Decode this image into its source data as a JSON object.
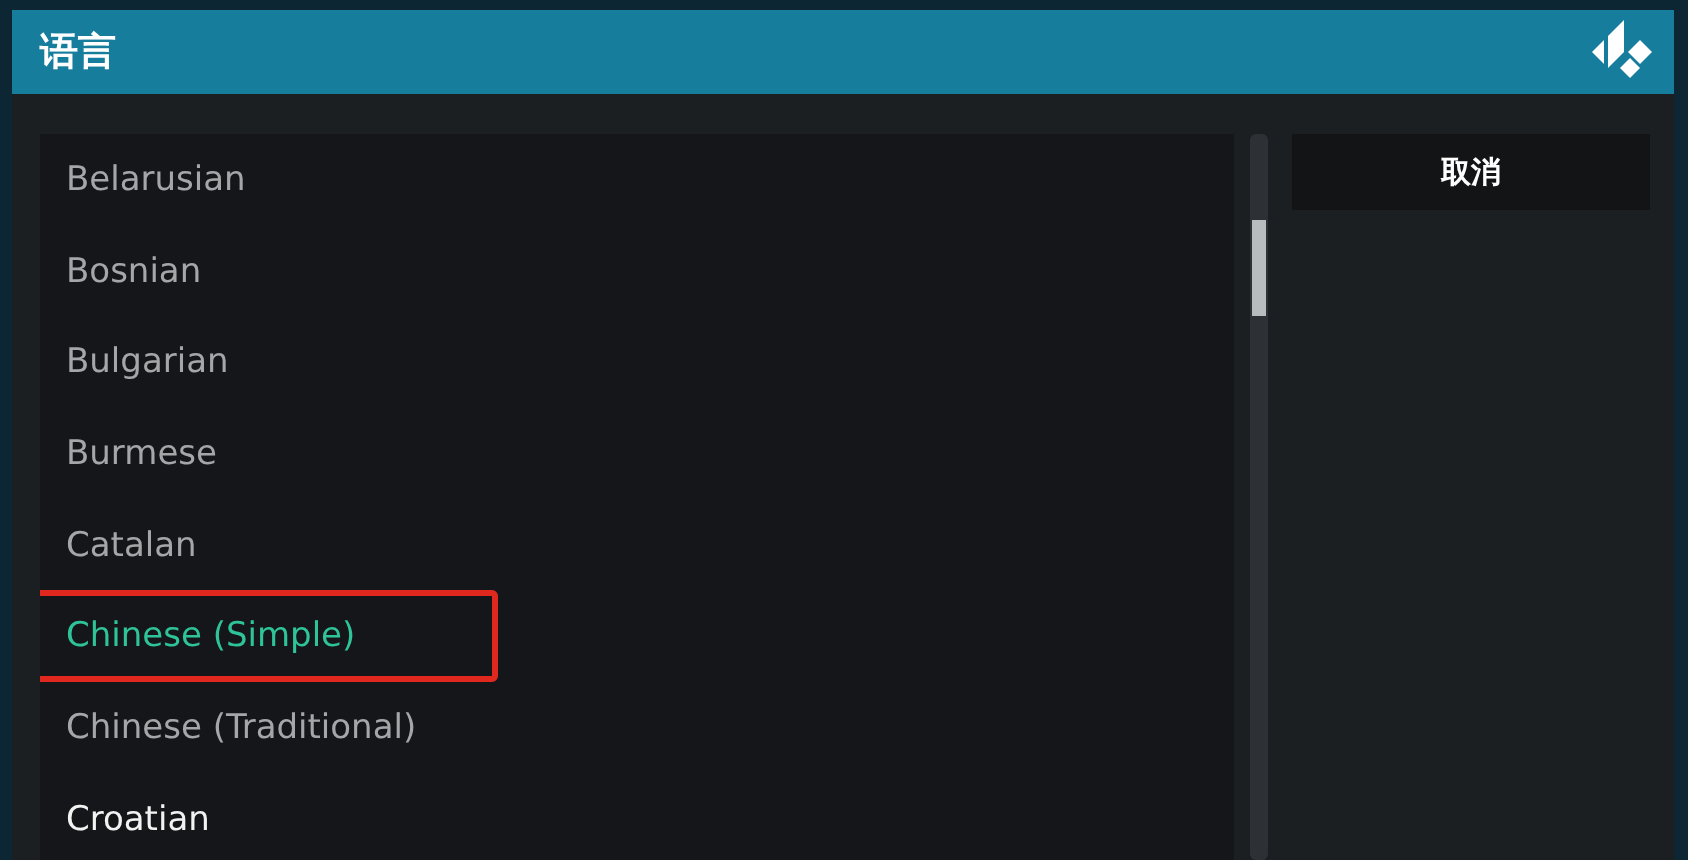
{
  "dialog": {
    "title": "语言"
  },
  "languages": [
    {
      "label": "Belarusian",
      "selected": false,
      "focused": false,
      "annotated": false
    },
    {
      "label": "Bosnian",
      "selected": false,
      "focused": false,
      "annotated": false
    },
    {
      "label": "Bulgarian",
      "selected": false,
      "focused": false,
      "annotated": false
    },
    {
      "label": "Burmese",
      "selected": false,
      "focused": false,
      "annotated": false
    },
    {
      "label": "Catalan",
      "selected": false,
      "focused": false,
      "annotated": false
    },
    {
      "label": "Chinese (Simple)",
      "selected": true,
      "focused": false,
      "annotated": true
    },
    {
      "label": "Chinese (Traditional)",
      "selected": false,
      "focused": false,
      "annotated": false
    },
    {
      "label": "Croatian",
      "selected": false,
      "focused": true,
      "annotated": false
    }
  ],
  "buttons": [
    {
      "label": "取消"
    }
  ]
}
